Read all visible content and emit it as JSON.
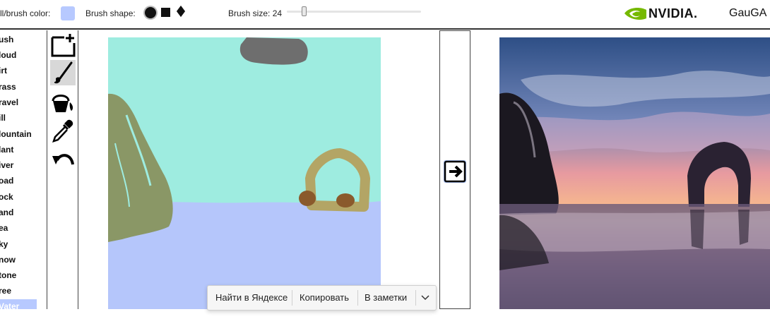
{
  "toolbar": {
    "fill_label": "ll/brush color:",
    "fill_color": "#b7c9ff",
    "shape_label": "Brush shape:",
    "shapes": [
      "circle",
      "square",
      "diamond"
    ],
    "selected_shape": "circle",
    "size_label": "Brush size: 24",
    "size_fraction": 0.12
  },
  "brand": {
    "logo_icon": "nvidia-eye-icon",
    "logo_color": "#76b900",
    "name": "NVIDIA.",
    "app": "GauGA"
  },
  "labels": {
    "items": [
      "ush",
      "loud",
      "irt",
      "rass",
      "ravel",
      "ill",
      "lountain",
      "lant",
      "iver",
      "oad",
      "ock",
      "and",
      "ea",
      "ky",
      "now",
      "tone",
      "ree",
      "Vater"
    ],
    "selected": "Vater"
  },
  "tools": [
    {
      "name": "new-canvas-icon"
    },
    {
      "name": "brush-icon"
    },
    {
      "name": "fill-bucket-icon"
    },
    {
      "name": "eyedropper-icon"
    },
    {
      "name": "undo-icon"
    }
  ],
  "convert": {
    "icon": "arrow-right-icon"
  },
  "canvas": {
    "sky_color": "#9eece0",
    "water_color": "#b5c6fb",
    "mountain_color": "#8a9766",
    "cloud_color": "#6e6e6e",
    "rock_color": "#b3a565",
    "dirt_color": "#8a5a2c"
  },
  "popup": {
    "items": [
      "Найти в Яндексе",
      "Копировать",
      "В заметки"
    ],
    "more_icon": "chevron-down-icon"
  }
}
